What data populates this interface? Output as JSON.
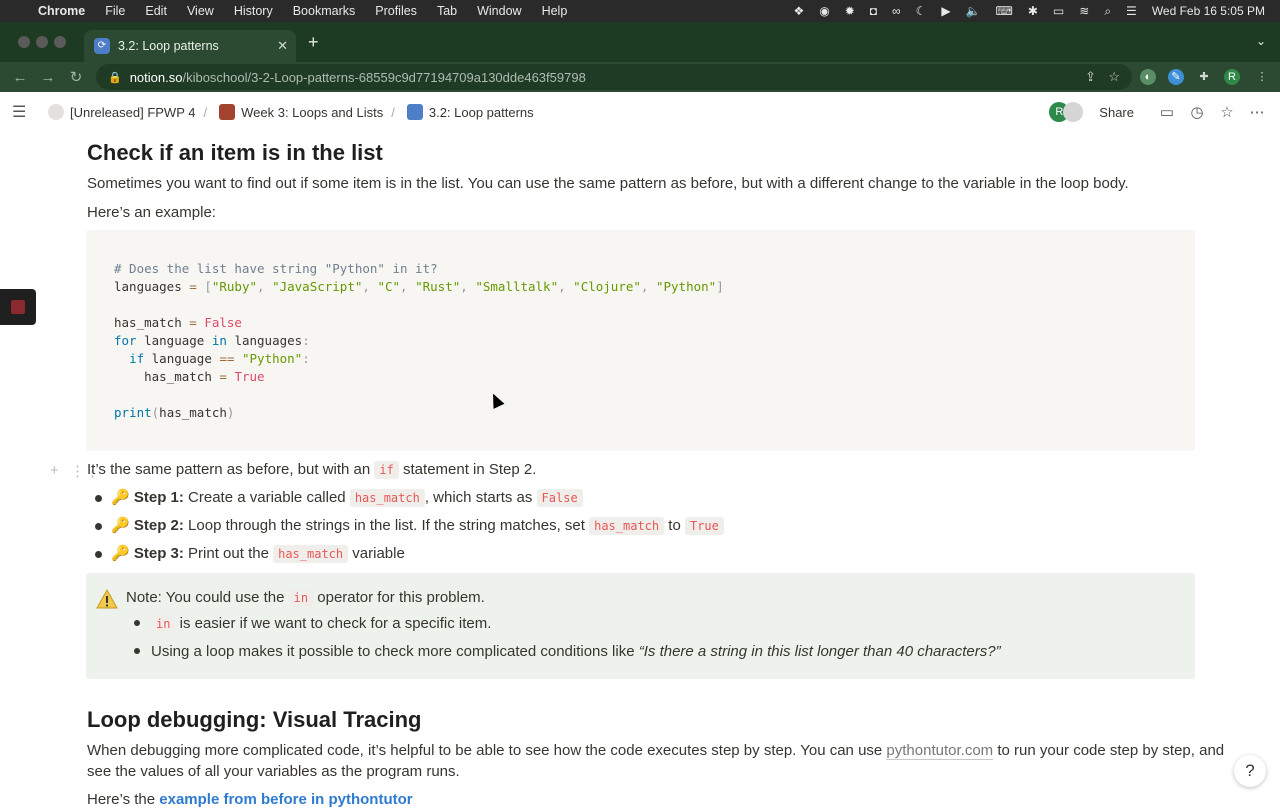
{
  "menubar": {
    "app": "Chrome",
    "items": [
      "File",
      "Edit",
      "View",
      "History",
      "Bookmarks",
      "Profiles",
      "Tab",
      "Window",
      "Help"
    ],
    "clock": "Wed Feb 16  5:05 PM"
  },
  "browser": {
    "tab_title": "3.2: Loop patterns",
    "url_host": "notion.so",
    "url_path": "/kiboschool/3-2-Loop-patterns-68559c9d77194709a130dde463f59798",
    "profile_initial": "R"
  },
  "notion": {
    "breadcrumbs": [
      "[Unreleased] FPWP 4",
      "Week 3: Loops and Lists",
      "3.2: Loop patterns"
    ],
    "avatar_initial": "R",
    "share_label": "Share"
  },
  "page": {
    "heading1": "Check if an item is in the list",
    "para1": "Sometimes you want to find out if some item is in the list. You can use the same pattern as before, but with a different change to the variable in the loop body.",
    "para2": "Here’s an example:",
    "code": {
      "comment": "# Does the list have string \"Python\" in it?",
      "l2_var": "languages",
      "l2_items": [
        "\"Ruby\"",
        "\"JavaScript\"",
        "\"C\"",
        "\"Rust\"",
        "\"Smalltalk\"",
        "\"Clojure\"",
        "\"Python\""
      ],
      "has_match": "has_match",
      "false_kw": "False",
      "true_kw": "True",
      "for_kw": "for",
      "in_kw": "in",
      "if_kw": "if",
      "language": "language",
      "python_str": "\"Python\"",
      "print_fn": "print"
    },
    "para3_a": "It’s the same pattern as before, but with an ",
    "para3_code": "if",
    "para3_b": " statement in Step 2.",
    "steps": [
      {
        "emoji": "🔑",
        "label": "Step 1:",
        "text_a": " Create a variable called ",
        "code1": "has_match",
        "text_b": ", which starts as ",
        "code2": "False"
      },
      {
        "emoji": "🔑",
        "label": "Step 2:",
        "text_a": " Loop through the strings in the list. If the string matches, set ",
        "code1": "has_match",
        "text_b": " to ",
        "code2": "True"
      },
      {
        "emoji": "🔑",
        "label": "Step 3:",
        "text_a": " Print out the ",
        "code1": "has_match",
        "text_b": " variable"
      }
    ],
    "callout": {
      "line1_a": "Note: You could use the ",
      "line1_code": "in",
      "line1_b": " operator for this problem.",
      "b1_code": "in",
      "b1_text": " is easier if we want to check for a specific item.",
      "b2_text": "Using a loop makes it possible to check more complicated conditions like ",
      "b2_italic": "“Is there a string in this list longer than 40 characters?”"
    },
    "heading2": "Loop debugging: Visual Tracing",
    "para4_a": "When debugging more complicated code, it’s helpful to be able to see how the code executes step by step. You can use ",
    "para4_link": "pythontutor.com",
    "para4_b": " to run your code step by step, and",
    "para4_c": "see the values of all your variables as the program runs.",
    "para5_a": "Here’s the ",
    "para5_link": "example from before in pythontutor"
  },
  "help_label": "?"
}
